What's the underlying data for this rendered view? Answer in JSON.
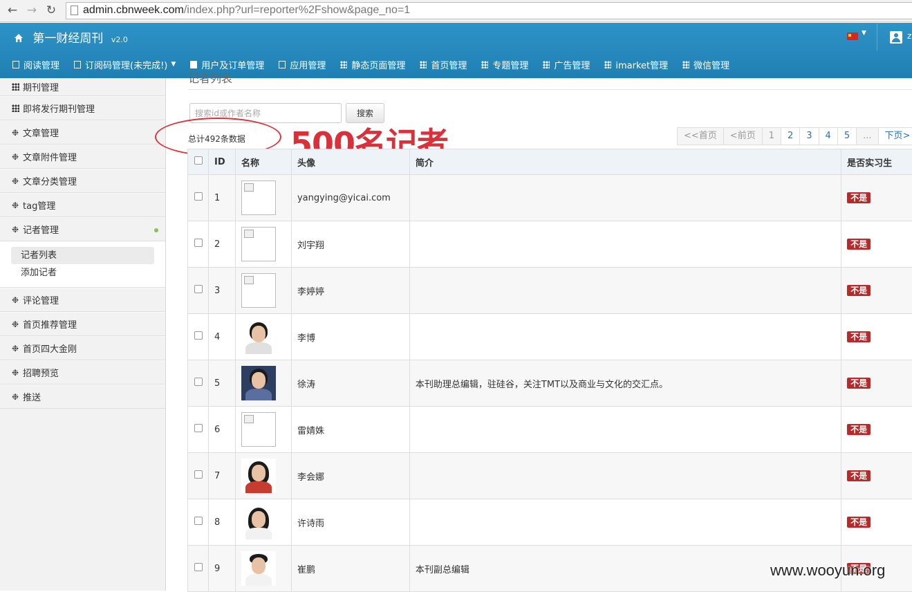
{
  "browser": {
    "url_host": "admin.cbnweek.com",
    "url_path": "/index.php?url=reporter%2Fshow&page_no=1"
  },
  "header": {
    "brand": "第一财经周刊",
    "version": "v2.0",
    "user_initial": "z",
    "menu": [
      {
        "label": "阅读管理",
        "icon": "doc-icon"
      },
      {
        "label": "订阅码管理(未完成!)",
        "icon": "list-icon",
        "dropdown": true
      },
      {
        "label": "用户及订单管理",
        "icon": "doc-icon"
      },
      {
        "label": "应用管理",
        "icon": "doc-icon"
      },
      {
        "label": "静态页面管理",
        "icon": "grid-icon"
      },
      {
        "label": "首页管理",
        "icon": "grid-icon"
      },
      {
        "label": "专题管理",
        "icon": "grid-icon"
      },
      {
        "label": "广告管理",
        "icon": "grid-icon"
      },
      {
        "label": "imarket管理",
        "icon": "grid-icon"
      },
      {
        "label": "微信管理",
        "icon": "grid-icon"
      }
    ]
  },
  "sidebar": {
    "items_top": [
      {
        "label": "期刊管理",
        "icon": "grid-icon"
      },
      {
        "label": "即将发行期刊管理",
        "icon": "grid-icon"
      },
      {
        "label": "文章管理",
        "icon": "gear-icon"
      },
      {
        "label": "文章附件管理",
        "icon": "gear-icon"
      },
      {
        "label": "文章分类管理",
        "icon": "gear-icon"
      },
      {
        "label": "tag管理",
        "icon": "gear-icon"
      },
      {
        "label": "记者管理",
        "icon": "gear-icon"
      }
    ],
    "sub_items": [
      "记者列表",
      "添加记者"
    ],
    "items_bottom": [
      {
        "label": "评论管理",
        "icon": "gear-icon"
      },
      {
        "label": "首页推荐管理",
        "icon": "gear-icon"
      },
      {
        "label": "首页四大金刚",
        "icon": "gear-icon"
      },
      {
        "label": "招聘预览",
        "icon": "gear-icon"
      },
      {
        "label": "推送",
        "icon": "gear-icon"
      }
    ]
  },
  "main": {
    "title": "记者列表",
    "search_placeholder": "搜索id或作者名称",
    "search_button": "搜索",
    "total_text": "总计492条数据",
    "annotation": "500名记者",
    "pagination": [
      "<<首页",
      "<前页",
      "1",
      "2",
      "3",
      "4",
      "5",
      "...",
      "下页>"
    ],
    "columns": [
      "ID",
      "名称",
      "头像",
      "简介",
      "是否实习生"
    ],
    "rows": [
      {
        "id": "1",
        "avatar": "broken",
        "name": "yangying@yicai.com",
        "intro": "",
        "intern": "不是"
      },
      {
        "id": "2",
        "avatar": "broken",
        "name": "刘宇翔",
        "intro": "",
        "intern": "不是"
      },
      {
        "id": "3",
        "avatar": "broken",
        "name": "李婷婷",
        "intro": "",
        "intern": "不是"
      },
      {
        "id": "4",
        "avatar": "photo",
        "name": "李博",
        "intro": "",
        "intern": "不是"
      },
      {
        "id": "5",
        "avatar": "photo",
        "name": "徐涛",
        "intro": "本刊助理总编辑，驻硅谷，关注TMT以及商业与文化的交汇点。",
        "intern": "不是"
      },
      {
        "id": "6",
        "avatar": "broken",
        "name": "雷婧姝",
        "intro": "",
        "intern": "不是"
      },
      {
        "id": "7",
        "avatar": "photo",
        "name": "李会娜",
        "intro": "",
        "intern": "不是"
      },
      {
        "id": "8",
        "avatar": "photo",
        "name": "许诗雨",
        "intro": "",
        "intern": "不是"
      },
      {
        "id": "9",
        "avatar": "photo",
        "name": "崔鹏",
        "intro": "本刊副总编辑",
        "intern": "不是"
      }
    ]
  },
  "watermark": "www.wooyun.org"
}
